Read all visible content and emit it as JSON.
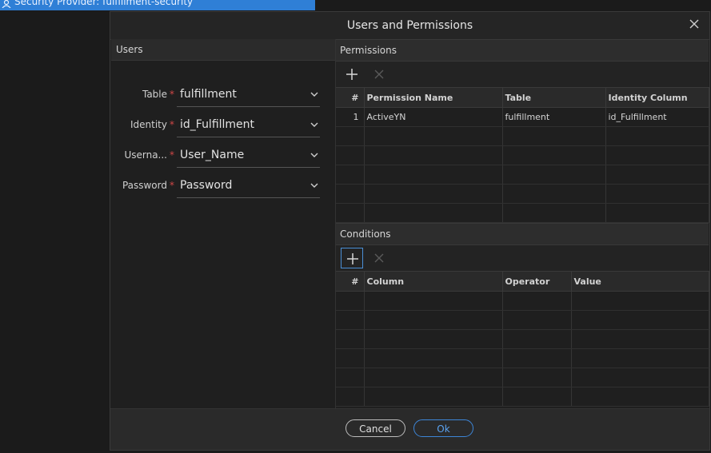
{
  "top_tab": {
    "text": "Security Provider: fulfillment-security"
  },
  "dialog": {
    "title": "Users and Permissions"
  },
  "users_panel": {
    "heading": "Users",
    "fields": [
      {
        "label": "Table",
        "required": "*",
        "value": "fulfillment"
      },
      {
        "label": "Identity",
        "required": "*",
        "value": "id_Fulfillment"
      },
      {
        "label": "Userna...",
        "required": "*",
        "value": "User_Name"
      },
      {
        "label": "Password",
        "required": "*",
        "value": "Password"
      }
    ]
  },
  "permissions": {
    "heading": "Permissions",
    "columns": [
      "#",
      "Permission Name",
      "Table",
      "Identity Column"
    ],
    "rows": [
      [
        "1",
        "ActiveYN",
        "fulfillment",
        "id_Fulfillment"
      ]
    ]
  },
  "conditions": {
    "heading": "Conditions",
    "columns": [
      "#",
      "Column",
      "Operator",
      "Value"
    ],
    "rows": []
  },
  "footer": {
    "cancel": "Cancel",
    "ok": "Ok"
  },
  "icons": {
    "add": "plus-icon",
    "delete": "x-icon",
    "close": "close-icon",
    "dropdown": "chevron-down-icon",
    "provider": "users-icon"
  },
  "colors": {
    "accent": "#3d86d8",
    "required": "#d04848",
    "tab": "#2f7fd6"
  }
}
